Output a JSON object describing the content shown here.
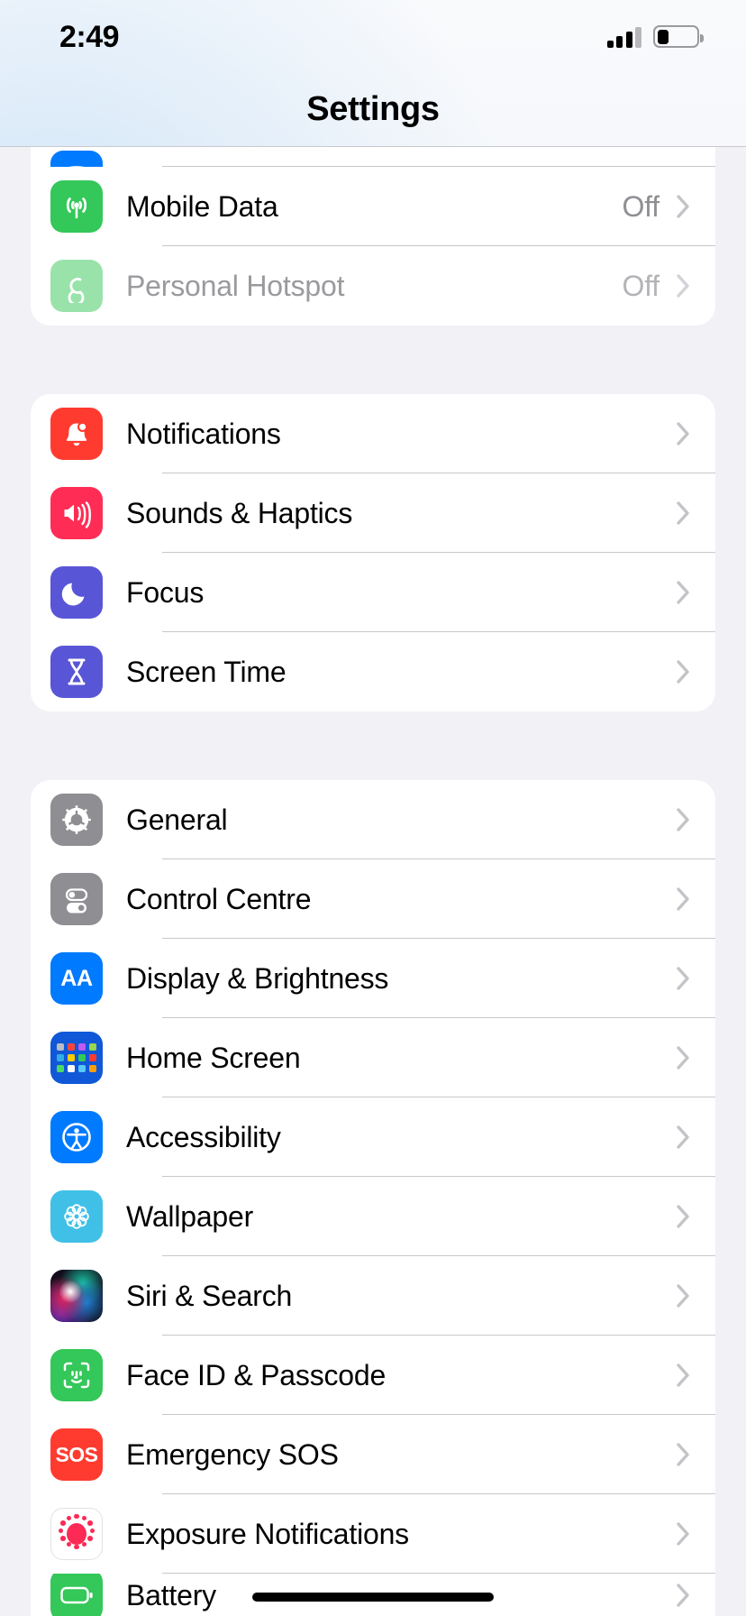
{
  "status_bar": {
    "time": "2:49",
    "signal_icon": "cellular-signal-icon",
    "signal_bars_filled": 3,
    "signal_bars_total": 4,
    "battery_icon": "battery-icon",
    "battery_percent": 30
  },
  "header": {
    "title": "Settings"
  },
  "colors": {
    "background": "#f2f1f6",
    "card": "#ffffff",
    "separator": "#c8c7cc",
    "secondary_text": "#8e8e93",
    "green": "#34c759",
    "red": "#ff3b30",
    "pink": "#ff2d55",
    "purple": "#5856d6",
    "gray": "#8e8e93",
    "blue": "#007aff",
    "light_blue": "#40c0e7",
    "home_screen_blue": "#1058d8",
    "exposure_pink": "#fc2a55"
  },
  "groups": [
    {
      "name": "connectivity-group",
      "clipped_top": true,
      "rows": [
        {
          "name": "row-wifi-partial",
          "label": "",
          "value": "",
          "icon": "wifi-icon",
          "partial": true,
          "dimmed": false
        },
        {
          "name": "row-mobile-data",
          "label": "Mobile Data",
          "value": "Off",
          "icon": "mobile-data-icon",
          "partial": false,
          "dimmed": false
        },
        {
          "name": "row-personal-hotspot",
          "label": "Personal Hotspot",
          "value": "Off",
          "icon": "personal-hotspot-icon",
          "partial": false,
          "dimmed": true
        }
      ]
    },
    {
      "name": "notifications-group",
      "clipped_top": false,
      "rows": [
        {
          "name": "row-notifications",
          "label": "Notifications",
          "value": "",
          "icon": "bell-icon",
          "partial": false,
          "dimmed": false
        },
        {
          "name": "row-sounds-haptics",
          "label": "Sounds & Haptics",
          "value": "",
          "icon": "speaker-icon",
          "partial": false,
          "dimmed": false
        },
        {
          "name": "row-focus",
          "label": "Focus",
          "value": "",
          "icon": "moon-icon",
          "partial": false,
          "dimmed": false
        },
        {
          "name": "row-screen-time",
          "label": "Screen Time",
          "value": "",
          "icon": "hourglass-icon",
          "partial": false,
          "dimmed": false
        }
      ]
    },
    {
      "name": "system-group",
      "clipped_top": false,
      "rows": [
        {
          "name": "row-general",
          "label": "General",
          "value": "",
          "icon": "gear-icon",
          "partial": false,
          "dimmed": false
        },
        {
          "name": "row-control-centre",
          "label": "Control Centre",
          "value": "",
          "icon": "toggles-icon",
          "partial": false,
          "dimmed": false
        },
        {
          "name": "row-display-brightness",
          "label": "Display & Brightness",
          "value": "",
          "icon": "aa-text-icon",
          "partial": false,
          "dimmed": false
        },
        {
          "name": "row-home-screen",
          "label": "Home Screen",
          "value": "",
          "icon": "app-grid-icon",
          "partial": false,
          "dimmed": false
        },
        {
          "name": "row-accessibility",
          "label": "Accessibility",
          "value": "",
          "icon": "accessibility-icon",
          "partial": false,
          "dimmed": false
        },
        {
          "name": "row-wallpaper",
          "label": "Wallpaper",
          "value": "",
          "icon": "flower-icon",
          "partial": false,
          "dimmed": false
        },
        {
          "name": "row-siri-search",
          "label": "Siri & Search",
          "value": "",
          "icon": "siri-orb-icon",
          "partial": false,
          "dimmed": false
        },
        {
          "name": "row-face-id-passcode",
          "label": "Face ID & Passcode",
          "value": "",
          "icon": "face-id-icon",
          "partial": false,
          "dimmed": false
        },
        {
          "name": "row-emergency-sos",
          "label": "Emergency SOS",
          "value": "",
          "icon": "sos-icon",
          "partial": false,
          "dimmed": false
        },
        {
          "name": "row-exposure-notifications",
          "label": "Exposure Notifications",
          "value": "",
          "icon": "exposure-dots-icon",
          "partial": false,
          "dimmed": false
        },
        {
          "name": "row-battery-partial",
          "label": "Battery",
          "value": "",
          "icon": "battery-settings-icon",
          "partial": true,
          "dimmed": false
        }
      ]
    }
  ],
  "home_indicator": "home-indicator"
}
